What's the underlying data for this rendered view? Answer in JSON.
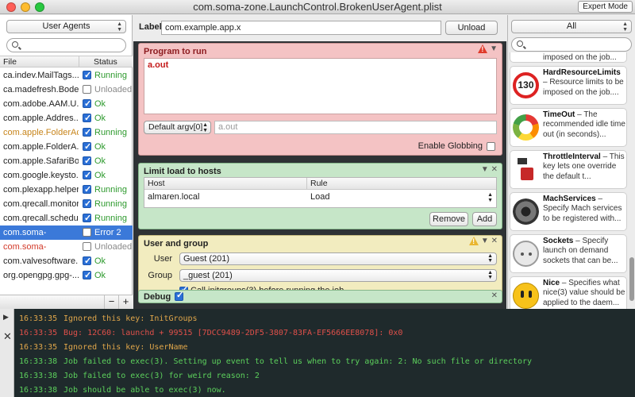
{
  "window": {
    "title": "com.soma-zone.LaunchControl.BrokenUserAgent.plist",
    "expert_mode_label": "Expert Mode"
  },
  "left_panel": {
    "selector_value": "User Agents",
    "search_placeholder": "",
    "columns": {
      "file": "File",
      "status": "Status"
    },
    "items": [
      {
        "file": "ca.indev.MailTags...",
        "enabled": true,
        "status": "Running",
        "status_color": "#2e9a2e",
        "file_color": "#222222"
      },
      {
        "file": "ca.madefresh.Bode...",
        "enabled": false,
        "status": "Unloaded",
        "status_color": "#8a8a8a",
        "file_color": "#222222"
      },
      {
        "file": "com.adobe.AAM.U...",
        "enabled": true,
        "status": "Ok",
        "status_color": "#2e9a2e",
        "file_color": "#222222"
      },
      {
        "file": "com.apple.Addres...",
        "enabled": true,
        "status": "Ok",
        "status_color": "#2e9a2e",
        "file_color": "#222222"
      },
      {
        "file": "com.apple.FolderActi",
        "enabled": true,
        "status": "Running",
        "status_color": "#2e9a2e",
        "file_color": "#c7841a"
      },
      {
        "file": "com.apple.FolderA...",
        "enabled": true,
        "status": "Ok",
        "status_color": "#2e9a2e",
        "file_color": "#222222"
      },
      {
        "file": "com.apple.SafariBo...",
        "enabled": true,
        "status": "Ok",
        "status_color": "#2e9a2e",
        "file_color": "#222222"
      },
      {
        "file": "com.google.keysto...",
        "enabled": true,
        "status": "Ok",
        "status_color": "#2e9a2e",
        "file_color": "#222222"
      },
      {
        "file": "com.plexapp.helper",
        "enabled": true,
        "status": "Running",
        "status_color": "#2e9a2e",
        "file_color": "#222222"
      },
      {
        "file": "com.qrecall.monitor",
        "enabled": true,
        "status": "Running",
        "status_color": "#2e9a2e",
        "file_color": "#222222"
      },
      {
        "file": "com.qrecall.scheduler",
        "enabled": true,
        "status": "Running",
        "status_color": "#2e9a2e",
        "file_color": "#222222"
      },
      {
        "file": "com.soma-",
        "enabled": false,
        "status": "Error 2",
        "status_color": "#ffffff",
        "file_color": "#ffffff",
        "selected": true
      },
      {
        "file": "com.soma-",
        "enabled": false,
        "status": "Unloaded",
        "status_color": "#8a8a8a",
        "file_color": "#d23a2a"
      },
      {
        "file": "com.valvesoftware...",
        "enabled": true,
        "status": "Ok",
        "status_color": "#2e9a2e",
        "file_color": "#222222"
      },
      {
        "file": "org.opengpg.gpg-...",
        "enabled": true,
        "status": "Ok",
        "status_color": "#2e9a2e",
        "file_color": "#222222"
      }
    ],
    "remove_label": "−",
    "add_label": "+"
  },
  "label_bar": {
    "label": "Label",
    "value": "com.example.app.x",
    "unload_label": "Unload"
  },
  "program_panel": {
    "title": "Program to run",
    "program_text": "a.out",
    "argv_selector": "Default argv[0]",
    "argv_value": "a.out",
    "globbing_label": "Enable Globbing",
    "globbing_enabled": false
  },
  "limit_panel": {
    "title": "Limit load to hosts",
    "columns": {
      "host": "Host",
      "rule": "Rule"
    },
    "rows": [
      {
        "host": "almaren.local",
        "rule": "Load"
      }
    ],
    "remove_label": "Remove",
    "add_label": "Add"
  },
  "user_panel": {
    "title": "User and group",
    "user_label": "User",
    "user_value": "Guest (201)",
    "group_label": "Group",
    "group_value": "_guest (201)",
    "initgroups_label": "Call initgroups(3) before running the job",
    "initgroups_enabled": true
  },
  "debug_panel": {
    "title": "Debug",
    "enabled": true
  },
  "right_panel": {
    "filter_value": "All",
    "search_placeholder": "",
    "cards": [
      {
        "partial": true,
        "text": "imposed on the job..."
      },
      {
        "title": "HardResourceLimits",
        "desc": " – Resource limits to be imposed on the job....",
        "icon": "speed-limit-130-icon"
      },
      {
        "title": "TimeOut",
        "desc": " – The recommended idle time out (in seconds)...",
        "icon": "timer-icon"
      },
      {
        "title": "ThrottleInterval",
        "desc": " – This key lets one override the default t...",
        "icon": "throttle-icon"
      },
      {
        "title": "MachServices",
        "desc": " – Specify Mach services to be registered with...",
        "icon": "speaker-icon"
      },
      {
        "title": "Sockets",
        "desc": " – Specify launch on demand sockets that can be...",
        "icon": "socket-icon"
      },
      {
        "title": "Nice",
        "desc": " – Specifies what nice(3) value should be applied to the daem...",
        "icon": "smiley-icon"
      }
    ]
  },
  "console": {
    "lines": [
      {
        "time": "16:33:35",
        "message": "Ignored this key: InitGroups",
        "color": "#e0a64a"
      },
      {
        "time": "16:33:35",
        "message": "Bug: 12C60: launchd + 99515 [7DCC9489-2DF5-3807-83FA-EF5666EE8078]: 0x0",
        "color": "#e0504a"
      },
      {
        "time": "16:33:35",
        "message": "Ignored this key: UserName",
        "color": "#e0a64a"
      },
      {
        "time": "16:33:38",
        "message": "Job failed to exec(3). Setting up event to tell us when to try again: 2: No such file or directory",
        "color": "#5cd05c"
      },
      {
        "time": "16:33:38",
        "message": "Job failed to exec(3) for weird reason: 2",
        "color": "#5cd05c"
      },
      {
        "time": "16:33:38",
        "message": "Job should be able to exec(3) now.",
        "color": "#5cd05c"
      }
    ]
  }
}
